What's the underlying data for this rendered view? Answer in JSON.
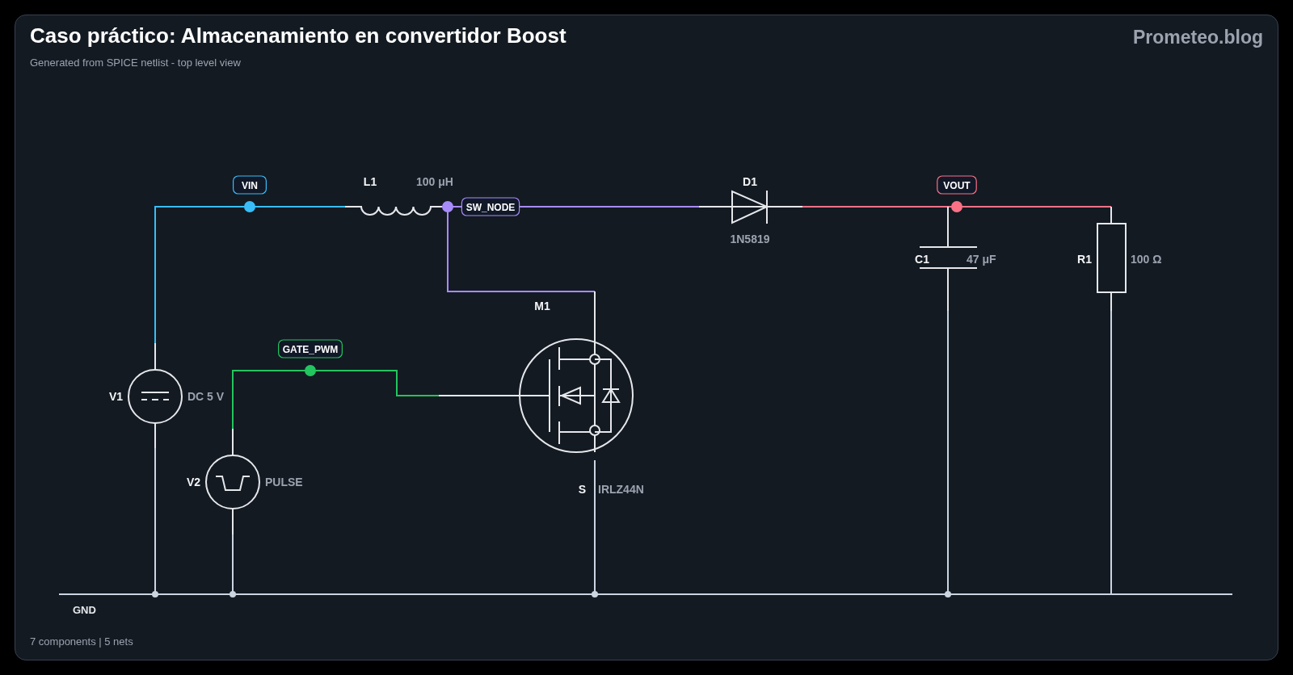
{
  "header": {
    "title": "Caso práctico: Almacenamiento en convertidor Boost",
    "subtitle": "Generated from SPICE netlist - top level view",
    "brand": "Prometeo.blog"
  },
  "components": [
    {
      "kind": "dc_source",
      "designator": "V1",
      "value": "DC 5 V"
    },
    {
      "kind": "inductor",
      "designator": "L1",
      "value": "100 μH"
    },
    {
      "kind": "diode",
      "designator": "D1",
      "value": "1N5819"
    },
    {
      "kind": "capacitor",
      "designator": "C1",
      "value": "47 μF"
    },
    {
      "kind": "resistor",
      "designator": "R1",
      "value": "100 Ω"
    },
    {
      "kind": "mosfet",
      "designator": "M1",
      "value": "IRLZ44N",
      "pin": "S"
    },
    {
      "kind": "pulse_source",
      "designator": "V2",
      "value": "PULSE"
    }
  ],
  "nets": [
    {
      "kind": "vin",
      "label": "VIN",
      "color": "#38bdf8"
    },
    {
      "kind": "sw",
      "label": "SW_NODE",
      "color": "#a78bfa"
    },
    {
      "kind": "vout",
      "label": "VOUT",
      "color": "#fb7185"
    },
    {
      "kind": "gate",
      "label": "GATE_PWM",
      "color": "#22c55e"
    },
    {
      "kind": "gnd",
      "label": "GND",
      "color": "#cbd5e1"
    }
  ],
  "footer": "7 components | 5 nets"
}
